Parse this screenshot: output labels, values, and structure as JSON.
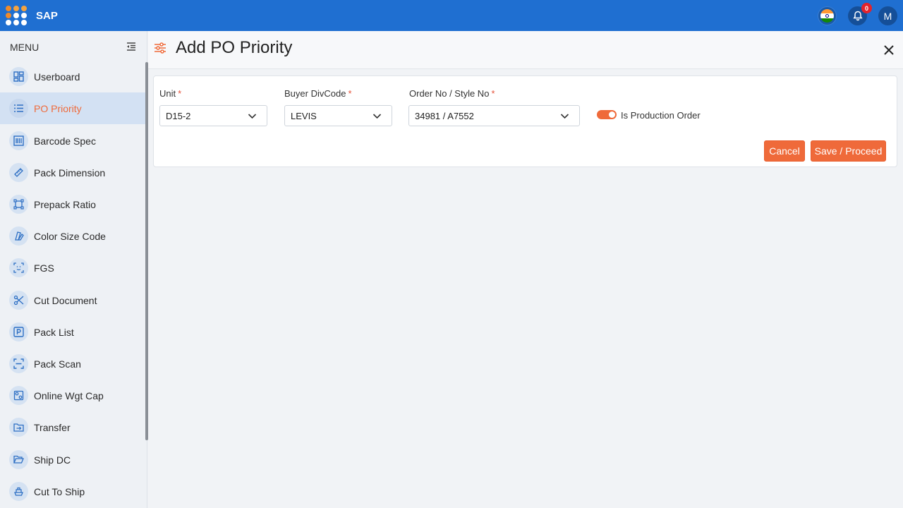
{
  "app": {
    "title": "SAP",
    "notifications_count": "0",
    "avatar_initial": "M"
  },
  "colors": {
    "topbar": "#1f6fd1",
    "accent": "#ef6a3a",
    "active_nav_bg": "#d3e1f3"
  },
  "sidebar": {
    "header": "MENU",
    "items": [
      {
        "label": "Userboard",
        "icon": "dashboard-icon",
        "active": false
      },
      {
        "label": "PO Priority",
        "icon": "list-icon",
        "active": true
      },
      {
        "label": "Barcode Spec",
        "icon": "barcode-icon",
        "active": false
      },
      {
        "label": "Pack Dimension",
        "icon": "ruler-icon",
        "active": false
      },
      {
        "label": "Prepack Ratio",
        "icon": "vector-square-icon",
        "active": false
      },
      {
        "label": "Color Size Code",
        "icon": "color-swatch-icon",
        "active": false
      },
      {
        "label": "FGS",
        "icon": "scan-face-icon",
        "active": false
      },
      {
        "label": "Cut Document",
        "icon": "scissors-icon",
        "active": false
      },
      {
        "label": "Pack List",
        "icon": "parking-square-icon",
        "active": false
      },
      {
        "label": "Pack Scan",
        "icon": "scan-icon",
        "active": false
      },
      {
        "label": "Online Wgt Cap",
        "icon": "grid-icon",
        "active": false
      },
      {
        "label": "Transfer",
        "icon": "folder-transfer-icon",
        "active": false
      },
      {
        "label": "Ship DC",
        "icon": "folder-open-icon",
        "active": false
      },
      {
        "label": "Cut To Ship",
        "icon": "ship-icon",
        "active": false
      }
    ]
  },
  "page": {
    "title": "Add PO Priority"
  },
  "form": {
    "unit": {
      "label": "Unit",
      "required_mark": "*",
      "value": "D15-2"
    },
    "buyer": {
      "label": "Buyer DivCode",
      "required_mark": "*",
      "value": "LEVIS"
    },
    "order": {
      "label": "Order No / Style No",
      "required_mark": "*",
      "value": "34981 / A7552"
    },
    "production_toggle": {
      "label": "Is Production Order",
      "checked": true
    },
    "cancel_label": "Cancel",
    "save_label": "Save / Proceed"
  }
}
